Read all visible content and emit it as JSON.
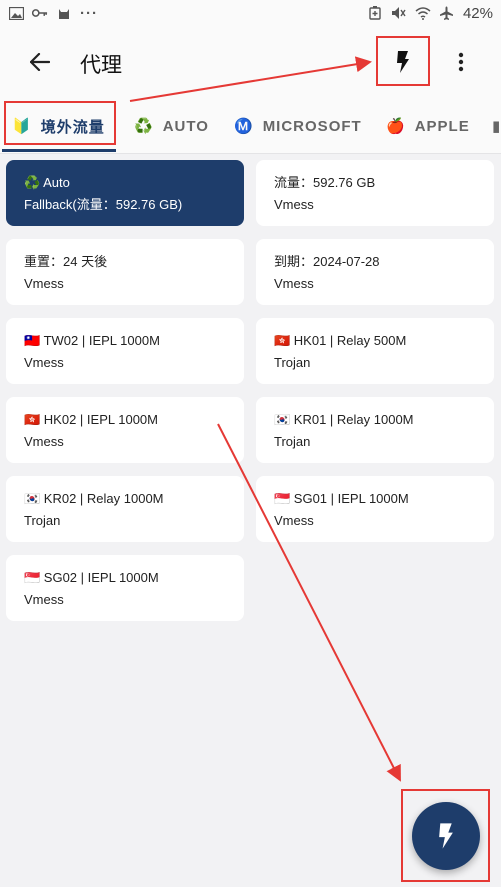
{
  "statusbar": {
    "battery": "42%",
    "dots": "···"
  },
  "appbar": {
    "title": "代理"
  },
  "tabs": [
    {
      "emoji": "🔰",
      "label": "境外流量"
    },
    {
      "emoji": "♻️",
      "label": "AUTO"
    },
    {
      "emoji": "Ⓜ️",
      "label": "MICROSOFT"
    },
    {
      "emoji": "🍎",
      "label": "APPLE"
    }
  ],
  "proxies": [
    {
      "name": "♻️ Auto",
      "type": "Fallback(流量：592.76 GB)"
    },
    {
      "name": "流量：592.76 GB",
      "type": "Vmess"
    },
    {
      "name": "重置：24 天後",
      "type": "Vmess"
    },
    {
      "name": "到期：2024-07-28",
      "type": "Vmess"
    },
    {
      "name": "🇹🇼 TW02 | IEPL 1000M",
      "type": "Vmess"
    },
    {
      "name": "🇭🇰 HK01 | Relay 500M",
      "type": "Trojan"
    },
    {
      "name": "🇭🇰 HK02 | IEPL 1000M",
      "type": "Vmess"
    },
    {
      "name": "🇰🇷 KR01 | Relay 1000M",
      "type": "Trojan"
    },
    {
      "name": "🇰🇷 KR02 | Relay 1000M",
      "type": "Trojan"
    },
    {
      "name": "🇸🇬 SG01 | IEPL 1000M",
      "type": "Vmess"
    },
    {
      "name": "🇸🇬 SG02 | IEPL 1000M",
      "type": "Vmess"
    }
  ],
  "colors": {
    "accent": "#1e3d6b",
    "annotation": "#e53935",
    "background": "#f2f2f4"
  }
}
